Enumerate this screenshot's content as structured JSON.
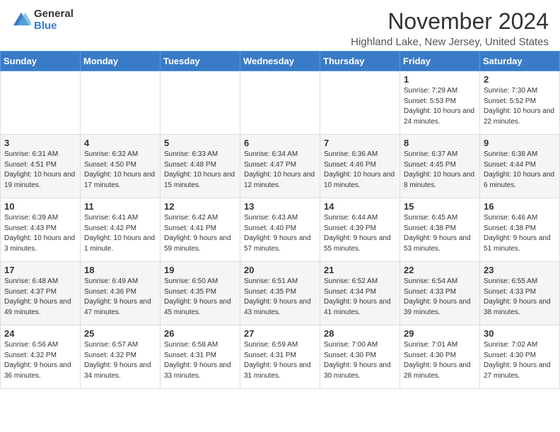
{
  "logo": {
    "general": "General",
    "blue": "Blue"
  },
  "title": "November 2024",
  "location": "Highland Lake, New Jersey, United States",
  "days_of_week": [
    "Sunday",
    "Monday",
    "Tuesday",
    "Wednesday",
    "Thursday",
    "Friday",
    "Saturday"
  ],
  "weeks": [
    [
      {
        "day": "",
        "info": ""
      },
      {
        "day": "",
        "info": ""
      },
      {
        "day": "",
        "info": ""
      },
      {
        "day": "",
        "info": ""
      },
      {
        "day": "",
        "info": ""
      },
      {
        "day": "1",
        "info": "Sunrise: 7:29 AM\nSunset: 5:53 PM\nDaylight: 10 hours and 24 minutes."
      },
      {
        "day": "2",
        "info": "Sunrise: 7:30 AM\nSunset: 5:52 PM\nDaylight: 10 hours and 22 minutes."
      }
    ],
    [
      {
        "day": "3",
        "info": "Sunrise: 6:31 AM\nSunset: 4:51 PM\nDaylight: 10 hours and 19 minutes."
      },
      {
        "day": "4",
        "info": "Sunrise: 6:32 AM\nSunset: 4:50 PM\nDaylight: 10 hours and 17 minutes."
      },
      {
        "day": "5",
        "info": "Sunrise: 6:33 AM\nSunset: 4:48 PM\nDaylight: 10 hours and 15 minutes."
      },
      {
        "day": "6",
        "info": "Sunrise: 6:34 AM\nSunset: 4:47 PM\nDaylight: 10 hours and 12 minutes."
      },
      {
        "day": "7",
        "info": "Sunrise: 6:36 AM\nSunset: 4:46 PM\nDaylight: 10 hours and 10 minutes."
      },
      {
        "day": "8",
        "info": "Sunrise: 6:37 AM\nSunset: 4:45 PM\nDaylight: 10 hours and 8 minutes."
      },
      {
        "day": "9",
        "info": "Sunrise: 6:38 AM\nSunset: 4:44 PM\nDaylight: 10 hours and 6 minutes."
      }
    ],
    [
      {
        "day": "10",
        "info": "Sunrise: 6:39 AM\nSunset: 4:43 PM\nDaylight: 10 hours and 3 minutes."
      },
      {
        "day": "11",
        "info": "Sunrise: 6:41 AM\nSunset: 4:42 PM\nDaylight: 10 hours and 1 minute."
      },
      {
        "day": "12",
        "info": "Sunrise: 6:42 AM\nSunset: 4:41 PM\nDaylight: 9 hours and 59 minutes."
      },
      {
        "day": "13",
        "info": "Sunrise: 6:43 AM\nSunset: 4:40 PM\nDaylight: 9 hours and 57 minutes."
      },
      {
        "day": "14",
        "info": "Sunrise: 6:44 AM\nSunset: 4:39 PM\nDaylight: 9 hours and 55 minutes."
      },
      {
        "day": "15",
        "info": "Sunrise: 6:45 AM\nSunset: 4:38 PM\nDaylight: 9 hours and 53 minutes."
      },
      {
        "day": "16",
        "info": "Sunrise: 6:46 AM\nSunset: 4:38 PM\nDaylight: 9 hours and 51 minutes."
      }
    ],
    [
      {
        "day": "17",
        "info": "Sunrise: 6:48 AM\nSunset: 4:37 PM\nDaylight: 9 hours and 49 minutes."
      },
      {
        "day": "18",
        "info": "Sunrise: 6:49 AM\nSunset: 4:36 PM\nDaylight: 9 hours and 47 minutes."
      },
      {
        "day": "19",
        "info": "Sunrise: 6:50 AM\nSunset: 4:35 PM\nDaylight: 9 hours and 45 minutes."
      },
      {
        "day": "20",
        "info": "Sunrise: 6:51 AM\nSunset: 4:35 PM\nDaylight: 9 hours and 43 minutes."
      },
      {
        "day": "21",
        "info": "Sunrise: 6:52 AM\nSunset: 4:34 PM\nDaylight: 9 hours and 41 minutes."
      },
      {
        "day": "22",
        "info": "Sunrise: 6:54 AM\nSunset: 4:33 PM\nDaylight: 9 hours and 39 minutes."
      },
      {
        "day": "23",
        "info": "Sunrise: 6:55 AM\nSunset: 4:33 PM\nDaylight: 9 hours and 38 minutes."
      }
    ],
    [
      {
        "day": "24",
        "info": "Sunrise: 6:56 AM\nSunset: 4:32 PM\nDaylight: 9 hours and 36 minutes."
      },
      {
        "day": "25",
        "info": "Sunrise: 6:57 AM\nSunset: 4:32 PM\nDaylight: 9 hours and 34 minutes."
      },
      {
        "day": "26",
        "info": "Sunrise: 6:58 AM\nSunset: 4:31 PM\nDaylight: 9 hours and 33 minutes."
      },
      {
        "day": "27",
        "info": "Sunrise: 6:59 AM\nSunset: 4:31 PM\nDaylight: 9 hours and 31 minutes."
      },
      {
        "day": "28",
        "info": "Sunrise: 7:00 AM\nSunset: 4:30 PM\nDaylight: 9 hours and 30 minutes."
      },
      {
        "day": "29",
        "info": "Sunrise: 7:01 AM\nSunset: 4:30 PM\nDaylight: 9 hours and 28 minutes."
      },
      {
        "day": "30",
        "info": "Sunrise: 7:02 AM\nSunset: 4:30 PM\nDaylight: 9 hours and 27 minutes."
      }
    ]
  ]
}
